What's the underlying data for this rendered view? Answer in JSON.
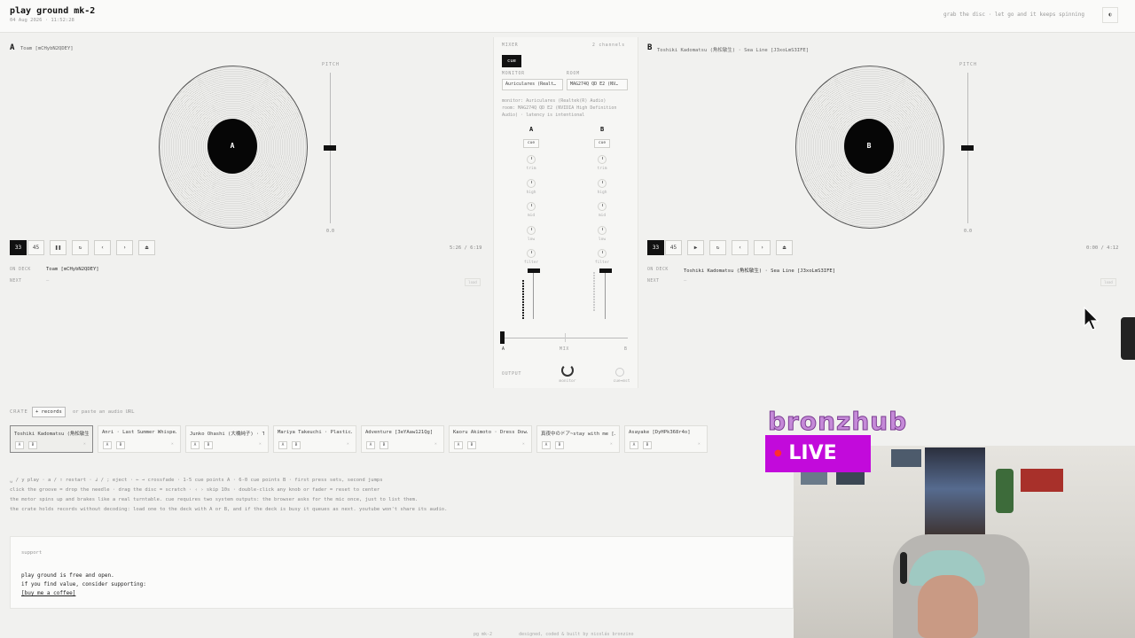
{
  "app": {
    "title": "play ground mk-2",
    "date": "04 Aug 2026 · 11:52:28",
    "tagline": "grab the disc · let go and it keeps spinning",
    "corner_icon": "◐"
  },
  "deck_a": {
    "letter": "A",
    "track": "Toam [mCHybN2QDEY]",
    "label_letter": "A",
    "pitch_label": "PITCH",
    "pitch_value": "0.0",
    "pitch_level": 0.5,
    "buttons": [
      "33",
      "45",
      "❚❚",
      "↻",
      "‹",
      "›",
      "⏏"
    ],
    "active_speed": "33",
    "time": "5:26 / 6:19",
    "on_deck_label": "ON DECK",
    "on_deck_value": "Toam [mCHybN2QDEY]",
    "next_label": "NEXT",
    "next_value": "—",
    "load_label": "load"
  },
  "deck_b": {
    "letter": "B",
    "track": "Toshiki Kadomatsu (角松敏生) · Sea Line [J3xoLmS3IFE]",
    "label_letter": "B",
    "pitch_label": "PITCH",
    "pitch_value": "0.0",
    "pitch_level": 0.5,
    "buttons": [
      "33",
      "45",
      "▶",
      "↻",
      "‹",
      "›",
      "⏏"
    ],
    "active_speed": "33",
    "time": "0:00 / 4:12",
    "on_deck_label": "ON DECK",
    "on_deck_value": "Toshiki Kadomatsu (角松敏生) · Sea Line [J3xoLmS3IFE]",
    "next_label": "NEXT",
    "next_value": "—",
    "load_label": "load"
  },
  "mixer": {
    "title": "MIXER",
    "channels": "2 channels",
    "cue_label": "cue",
    "monitor_label": "MONITOR",
    "monitor_value": "Auriculares (Realt…",
    "room_label": "ROOM",
    "room_value": "MAG274Q QD E2 (NV…",
    "desc_1": "monitor: Auriculares (Realtek(R) Audio)",
    "desc_2": "room: MAG274Q QD E2 (NVIDIA High Definition",
    "desc_3": "Audio) · latency is intentional",
    "ch_a": "A",
    "ch_b": "B",
    "ch_cue": "cue",
    "knobs": [
      "trim",
      "high",
      "mid",
      "low",
      "filter"
    ],
    "xfade_a": "A",
    "xfade_mix": "MIX",
    "xfade_b": "B",
    "output_label": "OUTPUT",
    "monitor_knob": "monitor",
    "cuemix_knob": "cue↔mst"
  },
  "crate": {
    "label": "CRATE",
    "button": "+ records",
    "hint": "or paste an audio URL",
    "records": [
      "Toshiki Kadomatsu (角松敏生)…",
      "Anri · Last Summer Whispe…",
      "Junko Ohashi (大橋純子) · T…",
      "Mariya Takeuchi · Plastic…",
      "Adventure [3eYAaw121Qg]",
      "Kaoru Akimoto · Dress Dow…",
      "真夜中のドア~stay with me […",
      "Asayake [DyHPk368r4o]"
    ],
    "ab_a": "A",
    "ab_b": "B",
    "x": "×"
  },
  "help": [
    "␣ / y play · a / ⇧ restart · ↲ / ; eject · ← → crossfade · 1-5 cue points A · 6-0 cue points B · first press sets, second jumps",
    "click the groove = drop the needle · drag the disc = scratch · ‹ › skip 10s · double-click any knob or fader = reset to center",
    "the motor spins up and brakes like a real turntable. cue requires two system outputs: the browser asks for the mic once, just to list them.",
    "the crate holds records without decoding: load one to the deck with A or B, and if the deck is busy it queues as next. youtube won't share its audio."
  ],
  "support": {
    "title": "support",
    "line1": "play ground is free and open.",
    "line2": "if you find value, consider supporting:",
    "link": "[buy me a coffee]"
  },
  "footer": {
    "left": "pg mk-2",
    "right": "designed, coded & built by nicolás bronzino"
  },
  "overlay": {
    "brand": "bronzhub",
    "live": "LIVE"
  }
}
